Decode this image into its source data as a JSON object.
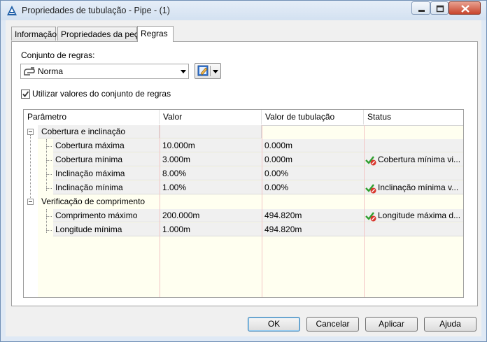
{
  "window": {
    "title": "Propriedades de tubulação - Pipe - (1)"
  },
  "tabs": [
    {
      "label": "Informação",
      "active": false
    },
    {
      "label": "Propriedades da peça",
      "active": false
    },
    {
      "label": "Regras",
      "active": true
    }
  ],
  "rules": {
    "ruleset_label": "Conjunto de regras:",
    "ruleset_value": "Norma",
    "use_ruleset_values_label": "Utilizar valores do conjunto de regras",
    "use_ruleset_values_checked": true
  },
  "grid": {
    "headers": [
      "Parâmetro",
      "Valor",
      "Valor de tubulação",
      "Status"
    ],
    "groups": [
      {
        "name": "Cobertura e inclinação",
        "rows": [
          {
            "param": "Cobertura máxima",
            "value": "10.000m",
            "pipe_value": "0.000m",
            "status": ""
          },
          {
            "param": "Cobertura mínima",
            "value": "3.000m",
            "pipe_value": "0.000m",
            "status": "Cobertura mínima vi..."
          },
          {
            "param": "Inclinação máxima",
            "value": "8.00%",
            "pipe_value": "0.00%",
            "status": ""
          },
          {
            "param": "Inclinação mínima",
            "value": "1.00%",
            "pipe_value": "0.00%",
            "status": "Inclinação mínima v..."
          }
        ]
      },
      {
        "name": "Verificação de comprimento",
        "rows": [
          {
            "param": "Comprimento máximo",
            "value": "200.000m",
            "pipe_value": "494.820m",
            "status": "Longitude máxima d..."
          },
          {
            "param": "Longitude mínima",
            "value": "1.000m",
            "pipe_value": "494.820m",
            "status": ""
          }
        ]
      }
    ]
  },
  "buttons": {
    "ok": "OK",
    "cancel": "Cancelar",
    "apply": "Aplicar",
    "help": "Ajuda"
  },
  "colors": {
    "grid_background": "#fffff0",
    "column_line": "#f2c4c4",
    "status_ok_check": "#2e9e2e",
    "status_error_badge": "#d9382e"
  }
}
